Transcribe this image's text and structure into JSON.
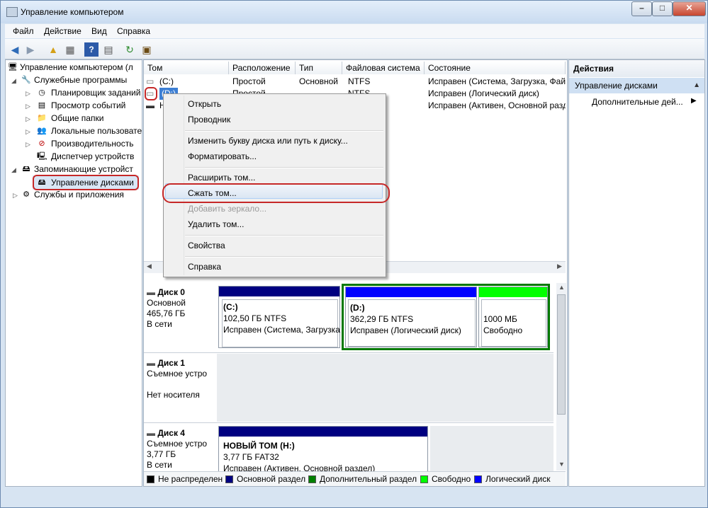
{
  "window": {
    "title": "Управление компьютером",
    "min": "–",
    "max": "□",
    "close": "✕"
  },
  "menubar": [
    "Файл",
    "Действие",
    "Вид",
    "Справка"
  ],
  "toolbar_icons": [
    "back-icon",
    "forward-icon",
    "up-folder-icon",
    "show-hide-tree-icon",
    "help-icon",
    "properties-icon",
    "refresh-icon",
    "export-icon"
  ],
  "tree": {
    "root": "Управление компьютером (л",
    "system_tools": "Служебные программы",
    "task_scheduler": "Планировщик заданий",
    "event_viewer": "Просмотр событий",
    "shared_folders": "Общие папки",
    "local_users": "Локальные пользовате",
    "performance": "Производительность",
    "device_manager": "Диспетчер устройств",
    "storage": "Запоминающие устройст",
    "disk_management": "Управление дисками",
    "services_apps": "Службы и приложения"
  },
  "volumes": {
    "headers": [
      "Том",
      "Расположение",
      "Тип",
      "Файловая система",
      "Состояние"
    ],
    "rows": [
      [
        "(C:)",
        "Простой",
        "Основной",
        "NTFS",
        "Исправен (Система, Загрузка, Фай..."
      ],
      [
        "(D:)",
        "Простой",
        "",
        "NTFS",
        "Исправен (Логический диск)"
      ],
      [
        "Н",
        "",
        "",
        "",
        "Исправен (Активен, Основной разд"
      ]
    ]
  },
  "context_menu": {
    "open": "Открыть",
    "explorer": "Проводник",
    "change_letter": "Изменить букву диска или путь к диску...",
    "format": "Форматировать...",
    "extend": "Расширить том...",
    "shrink": "Сжать том...",
    "add_mirror": "Добавить зеркало...",
    "delete": "Удалить том...",
    "properties": "Свойства",
    "help": "Справка"
  },
  "disks": {
    "disk0": {
      "name": "Диск 0",
      "type": "Основной",
      "size": "465,76 ГБ",
      "status": "В сети",
      "c_name": "(C:)",
      "c_size": "102,50 ГБ NTFS",
      "c_status": "Исправен (Система, Загрузка",
      "d_name": "(D:)",
      "d_size": "362,29 ГБ NTFS",
      "d_status": "Исправен (Логический диск)",
      "free_size": "1000 МБ",
      "free_status": "Свободно"
    },
    "disk1": {
      "name": "Диск 1",
      "type": "Съемное устро",
      "status": "Нет носителя"
    },
    "disk4": {
      "name": "Диск 4",
      "type": "Съемное устро",
      "size": "3,77 ГБ",
      "status": "В сети",
      "h_name": "НОВЫЙ ТОМ  (H:)",
      "h_size": "3,77 ГБ FAT32",
      "h_status": "Исправен (Активен, Основной раздел)"
    }
  },
  "legend": [
    {
      "label": "Не распределен",
      "color": "#000000"
    },
    {
      "label": "Основной раздел",
      "color": "#000080"
    },
    {
      "label": "Дополнительный раздел",
      "color": "#008000"
    },
    {
      "label": "Свободно",
      "color": "#00ff00"
    },
    {
      "label": "Логический диск",
      "color": "#0000ff"
    }
  ],
  "actions": {
    "title": "Действия",
    "section": "Управление дисками",
    "more": "Дополнительные дей..."
  }
}
